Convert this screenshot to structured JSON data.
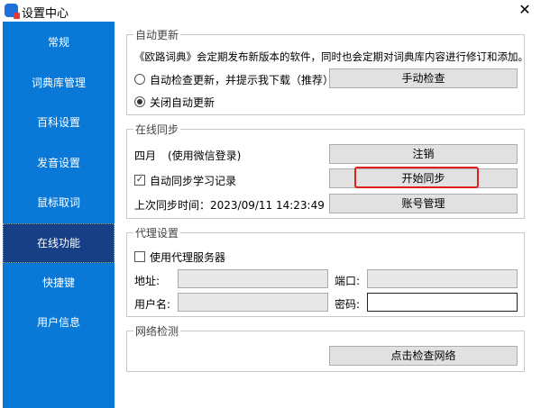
{
  "window": {
    "title": "设置中心",
    "close": "✕"
  },
  "sidebar": {
    "items": [
      {
        "label": "常规"
      },
      {
        "label": "词典库管理"
      },
      {
        "label": "百科设置"
      },
      {
        "label": "发音设置"
      },
      {
        "label": "鼠标取词"
      },
      {
        "label": "在线功能",
        "selected": true
      },
      {
        "label": "快捷键"
      },
      {
        "label": "用户信息"
      }
    ]
  },
  "auto_update": {
    "legend": "自动更新",
    "description": "《欧路词典》会定期发布新版本的软件，同时也会定期对词典库内容进行修订和添加。",
    "option_auto": "自动检查更新，并提示我下载（推荐）",
    "option_off": "关闭自动更新",
    "selected": "关闭自动更新",
    "manual_check": "手动检查"
  },
  "online_sync": {
    "legend": "在线同步",
    "user": "四月",
    "login_method": "(使用微信登录)",
    "logout": "注销",
    "auto_sync_label": "自动同步学习记录",
    "auto_sync_checked": true,
    "start_sync": "开始同步",
    "last_sync": "上次同步时间：2023/09/11 14:23:49",
    "account_manage": "账号管理"
  },
  "proxy": {
    "legend": "代理设置",
    "use_proxy_label": "使用代理服务器",
    "use_proxy_checked": false,
    "address_label": "地址:",
    "port_label": "端口:",
    "username_label": "用户名:",
    "password_label": "密码:",
    "address": "",
    "port": "",
    "username": "",
    "password": ""
  },
  "network": {
    "legend": "网络检测",
    "check": "点击检查网络"
  },
  "colors": {
    "sidebar": "#0978d6",
    "selected": "#163f86",
    "highlight": "#e0201c"
  }
}
